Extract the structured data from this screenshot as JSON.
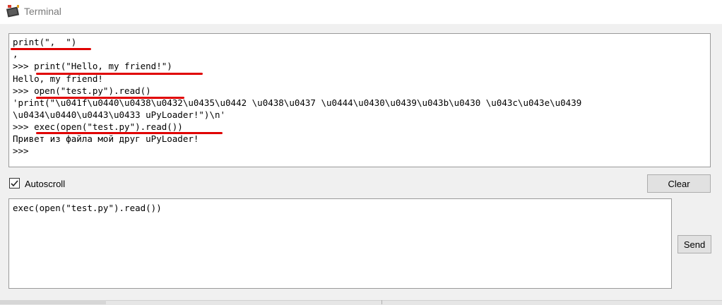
{
  "window": {
    "title": "Terminal",
    "app_icon": "terminal-app-icon"
  },
  "output": {
    "lines": [
      "print(\",  \")",
      ",",
      ">>> print(\"Hello, my friend!\")",
      "Hello, my friend!",
      ">>> open(\"test.py\").read()",
      "'print(\"\\u041f\\u0440\\u0438\\u0432\\u0435\\u0442 \\u0438\\u0437 \\u0444\\u0430\\u0439\\u043b\\u0430 \\u043c\\u043e\\u0439",
      "\\u0434\\u0440\\u0443\\u0433 uPyLoader!\")\\n'",
      ">>> exec(open(\"test.py\").read())",
      "Привет из файла мой друг uPyLoader!",
      ">>>"
    ],
    "highlight_color": "#e00000"
  },
  "controls": {
    "autoscroll_label": "Autoscroll",
    "autoscroll_checked": true,
    "clear_label": "Clear",
    "send_label": "Send"
  },
  "input": {
    "value": "exec(open(\"test.py\").read())"
  }
}
